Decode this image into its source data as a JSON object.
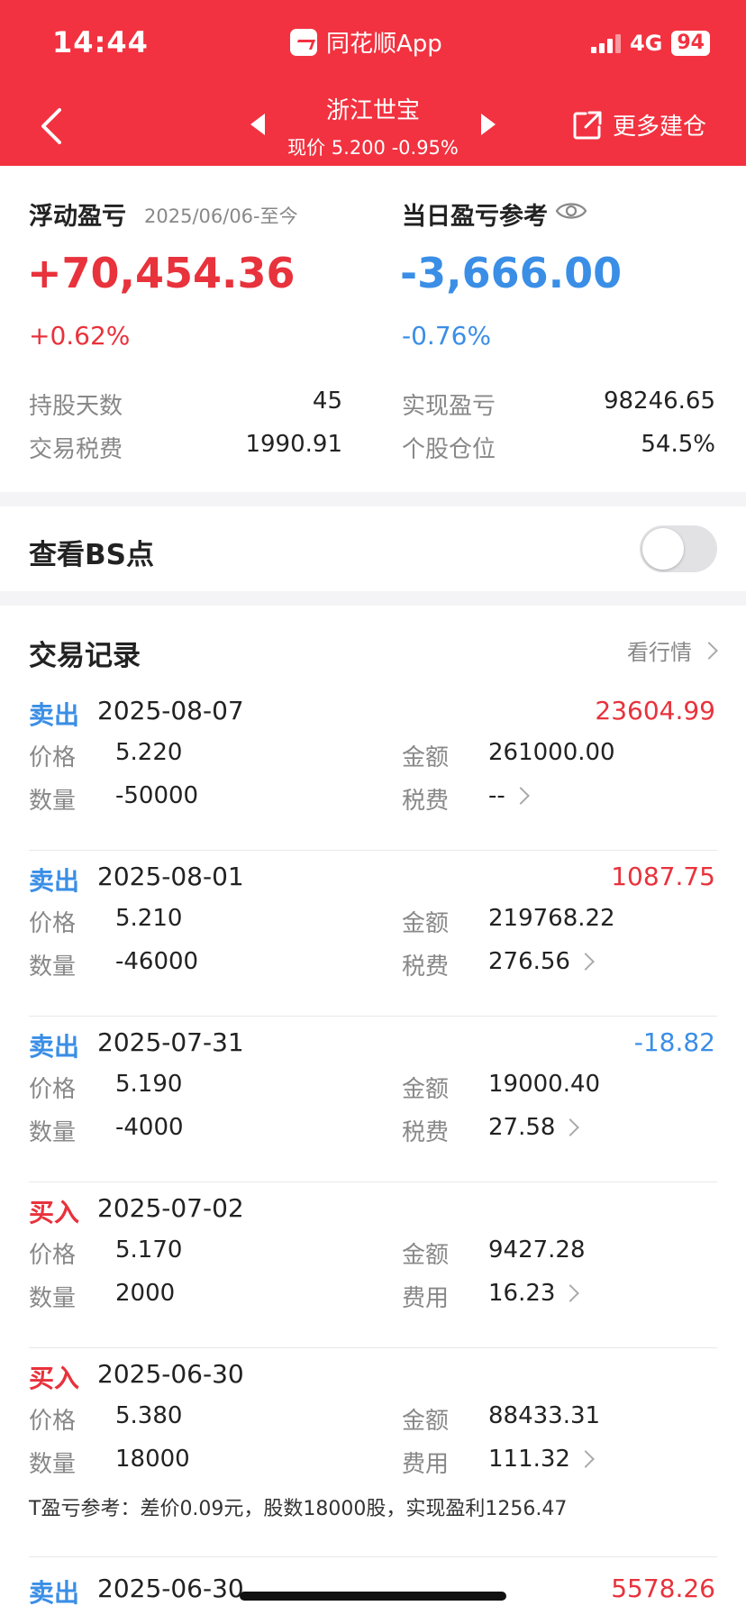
{
  "status": {
    "time": "14:44",
    "app_name": "同花顺App",
    "network": "4G",
    "battery": "94"
  },
  "header": {
    "stock_name": "浙江世宝",
    "price_line": "现价 5.200 -0.95%",
    "more_label": "更多建仓"
  },
  "summary": {
    "floating_label": "浮动盈亏",
    "floating_period": "2025/06/06-至今",
    "floating_value": "+70,454.36",
    "floating_pct": "+0.62%",
    "daily_label": "当日盈亏参考",
    "daily_value": "-3,666.00",
    "daily_pct": "-0.76%",
    "hold_days_label": "持股天数",
    "hold_days": "45",
    "realized_label": "实现盈亏",
    "realized": "98246.65",
    "tax_label": "交易税费",
    "tax": "1990.91",
    "position_label": "个股仓位",
    "position": "54.5%"
  },
  "bs": {
    "label": "查看BS点",
    "enabled": false
  },
  "trades_section": {
    "title": "交易记录",
    "link": "看行情"
  },
  "trades": [
    {
      "type": "卖出",
      "date": "2025-08-07",
      "pl": "23604.99",
      "price_label": "价格",
      "price": "5.220",
      "qty_label": "数量",
      "qty": "-50000",
      "amount_label": "金额",
      "amount": "261000.00",
      "fee_label": "税费",
      "fee": "--"
    },
    {
      "type": "卖出",
      "date": "2025-08-01",
      "pl": "1087.75",
      "price_label": "价格",
      "price": "5.210",
      "qty_label": "数量",
      "qty": "-46000",
      "amount_label": "金额",
      "amount": "219768.22",
      "fee_label": "税费",
      "fee": "276.56"
    },
    {
      "type": "卖出",
      "date": "2025-07-31",
      "pl": "-18.82",
      "price_label": "价格",
      "price": "5.190",
      "qty_label": "数量",
      "qty": "-4000",
      "amount_label": "金额",
      "amount": "19000.40",
      "fee_label": "税费",
      "fee": "27.58"
    },
    {
      "type": "买入",
      "date": "2025-07-02",
      "pl": "",
      "price_label": "价格",
      "price": "5.170",
      "qty_label": "数量",
      "qty": "2000",
      "amount_label": "金额",
      "amount": "9427.28",
      "fee_label": "费用",
      "fee": "16.23"
    },
    {
      "type": "买入",
      "date": "2025-06-30",
      "pl": "",
      "price_label": "价格",
      "price": "5.380",
      "qty_label": "数量",
      "qty": "18000",
      "amount_label": "金额",
      "amount": "88433.31",
      "fee_label": "费用",
      "fee": "111.32",
      "note": "T盈亏参考：差价0.09元，股数18000股，实现盈利1256.47"
    },
    {
      "type": "卖出",
      "date": "2025-06-30",
      "pl": "5578.26"
    }
  ],
  "colors": {
    "header_red": "#f23240",
    "profit_red": "#e8323c",
    "loss_blue": "#3a8ee6"
  }
}
